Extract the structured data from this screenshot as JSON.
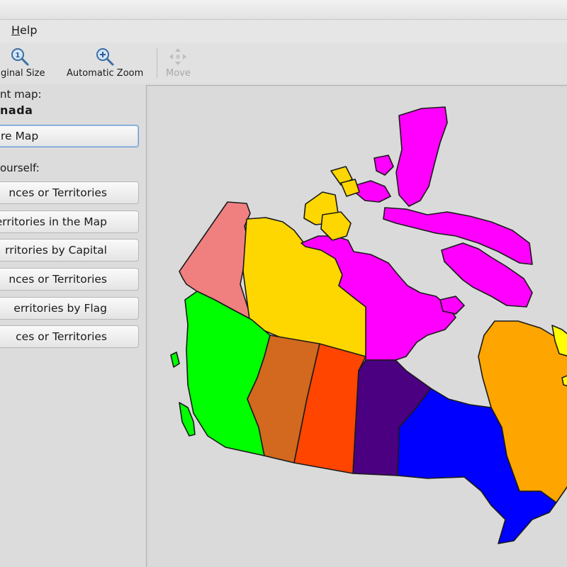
{
  "menubar": {
    "help_label_first": "H",
    "help_label_rest": "elp"
  },
  "toolbar": {
    "original_size_label": "riginal Size",
    "automatic_zoom_label": "Automatic Zoom",
    "move_label": "Move"
  },
  "sidebar": {
    "current_map_label": "nt map:",
    "current_map_value": "nada",
    "choose_map_button": "re Map",
    "test_yourself_label": "ourself:",
    "game_buttons": [
      "nces or Territories",
      "Territories in the Map",
      "rritories by Capital",
      "nces or Territories",
      "erritories by Flag",
      "ces or Territories"
    ]
  },
  "map": {
    "region_colors": {
      "yukon": "#f08080",
      "northwest_territories": "#ffd700",
      "nunavut": "#ff00ff",
      "british_columbia": "#00ff00",
      "alberta": "#d2691e",
      "saskatchewan": "#ff4500",
      "manitoba": "#4b0082",
      "ontario": "#0000ff",
      "quebec": "#ffa500",
      "labrador": "#ffff00"
    }
  }
}
